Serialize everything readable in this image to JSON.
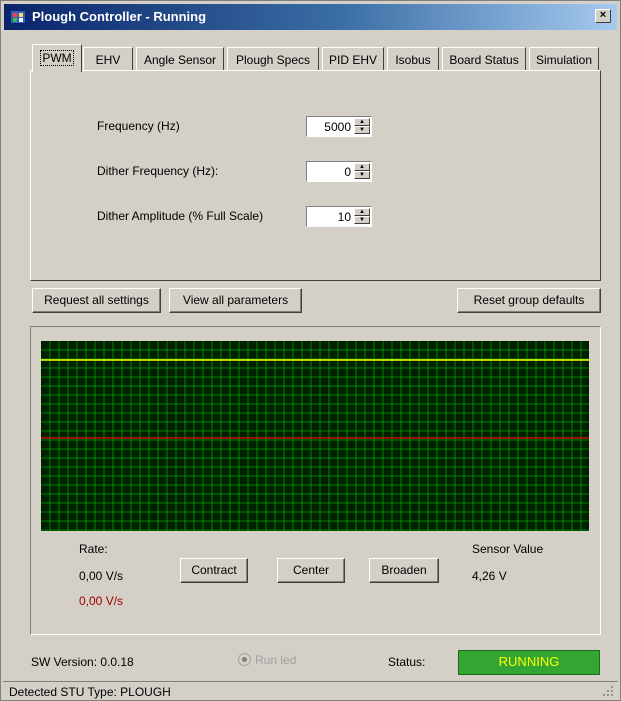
{
  "window": {
    "title": "Plough Controller - Running",
    "close_glyph": "×"
  },
  "tabs": [
    {
      "label": "PWM",
      "active": true
    },
    {
      "label": "EHV"
    },
    {
      "label": "Angle Sensor"
    },
    {
      "label": "Plough Specs"
    },
    {
      "label": "PID EHV"
    },
    {
      "label": "Isobus"
    },
    {
      "label": "Board Status"
    },
    {
      "label": "Simulation"
    }
  ],
  "pwm": {
    "frequency_label": "Frequency (Hz)",
    "frequency_value": "5000",
    "dither_freq_label": "Dither Frequency (Hz):",
    "dither_freq_value": "0",
    "dither_amp_label": "Dither Amplitude (% Full Scale)",
    "dither_amp_value": "10"
  },
  "actions": {
    "request_all": "Request all settings",
    "view_all": "View all parameters",
    "reset_group": "Reset group defaults"
  },
  "scope": {
    "background": "#002000",
    "grid_color": "#00a000",
    "line1_color": "#ffff00",
    "line1_level": 0.9,
    "line2_color": "#c01010",
    "line2_level": 0.49
  },
  "controls": {
    "rate_label": "Rate:",
    "rate_value": "0,00 V/s",
    "rate_value_alt": "0,00 V/s",
    "rate_alt_color": "#a00000",
    "contract_label": "Contract",
    "center_label": "Center",
    "broaden_label": "Broaden",
    "sensor_label": "Sensor Value",
    "sensor_value": "4,26 V"
  },
  "footer": {
    "sw_version": "SW Version: 0.0.18",
    "run_led_label": "Run led",
    "status_label": "Status:",
    "status_value": "RUNNING",
    "status_color": "#33a533"
  },
  "statusbar": {
    "text": "Detected STU Type: PLOUGH"
  }
}
